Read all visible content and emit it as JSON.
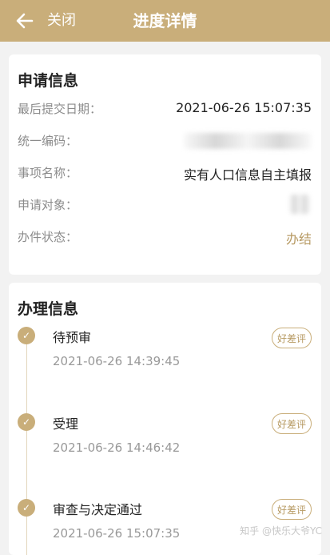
{
  "header": {
    "close_label": "关闭",
    "title": "进度详情",
    "background_color": "#c9ae7a"
  },
  "application_info": {
    "title": "申请信息",
    "rows": [
      {
        "label": "最后提交日期：",
        "value": "2021-06-26 15:07:35"
      },
      {
        "label": "统一编码：",
        "value": ""
      },
      {
        "label": "事项名称：",
        "value": "实有人口信息自主填报"
      },
      {
        "label": "申请对象：",
        "value": ""
      },
      {
        "label": "办件状态：",
        "value": "办结"
      }
    ]
  },
  "process_info": {
    "title": "办理信息",
    "steps": [
      {
        "name": "待预审",
        "time": "2021-06-26 14:39:45",
        "rate_label": "好差评"
      },
      {
        "name": "受理",
        "time": "2021-06-26 14:46:42",
        "rate_label": "好差评"
      },
      {
        "name": "审查与决定通过",
        "time": "2021-06-26 15:07:35",
        "rate_label": "好差评"
      }
    ]
  },
  "watermark": "知乎 @快乐大爷YC",
  "colors": {
    "accent": "#c9ae7a",
    "status": "#b79a63"
  }
}
